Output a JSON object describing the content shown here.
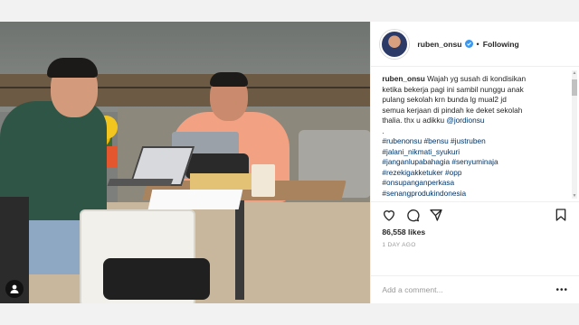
{
  "post": {
    "username": "ruben_onsu",
    "separator": "•",
    "follow_label": "Following",
    "caption_lines": [
      "Wajah yg susah di kondisikan",
      "ketika bekerja pagi ini sambil nunggu anak",
      "pulang sekolah krn bunda lg mual2 jd",
      "semua kerjaan di pindah ke deket sekolah",
      "thalia. thx u adikku",
      "@jordionsu",
      ".",
      "#rubenonsu #bensu #justruben",
      "#jalani_nikmati_syukuri",
      "#janganlupabahagia #senyuminaja",
      "#rezekigakketuker #opp",
      "#onsupanganperkasa",
      "#senangprodukindonesia"
    ],
    "likes": "86,558 likes",
    "time_ago": "1 DAY AGO",
    "comment_placeholder": "Add a comment...",
    "more_label": "•••"
  },
  "colors": {
    "verified": "#3897f0",
    "link": "#003569",
    "text": "#262626",
    "muted": "#999999"
  },
  "icons": [
    "verified-badge-icon",
    "heart-icon",
    "comment-icon",
    "share-icon",
    "bookmark-icon",
    "user-tag-icon",
    "more-icon"
  ]
}
